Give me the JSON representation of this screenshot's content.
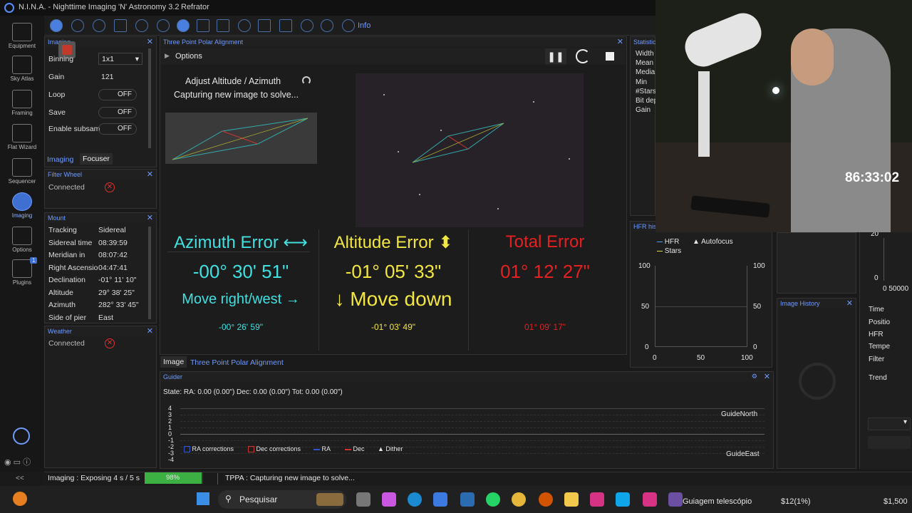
{
  "app": {
    "title": "N.I.N.A. - Nighttime Imaging 'N' Astronomy 3.2",
    "profile": "Refrator"
  },
  "nav": [
    {
      "label": "Equipment"
    },
    {
      "label": "Sky Atlas"
    },
    {
      "label": "Framing"
    },
    {
      "label": "Flat Wizard"
    },
    {
      "label": "Sequencer"
    },
    {
      "label": "Imaging"
    },
    {
      "label": "Options"
    },
    {
      "label": "Plugins"
    }
  ],
  "plugins_badge": "1",
  "toolbar": {
    "info": "Info"
  },
  "imaging_panel": {
    "title": "Imaging",
    "binning_label": "Binning",
    "binning_value": "1x1",
    "gain_label": "Gain",
    "gain_value": "121",
    "loop_label": "Loop",
    "loop_value": "OFF",
    "save_label": "Save",
    "save_value": "OFF",
    "subsample_label": "Enable subsam",
    "subsample_value": "OFF",
    "tab_imaging": "Imaging",
    "tab_focuser": "Focuser"
  },
  "filter_wheel": {
    "title": "Filter Wheel",
    "status": "Connected"
  },
  "mount": {
    "title": "Mount",
    "rows": [
      {
        "label": "Tracking",
        "value": "Sidereal"
      },
      {
        "label": "Sidereal time",
        "value": "08:39:59"
      },
      {
        "label": "Meridian in",
        "value": "08:07:42"
      },
      {
        "label": "Right Ascensio",
        "value": "04:47:41"
      },
      {
        "label": "Declination",
        "value": "-01° 11' 10\""
      },
      {
        "label": "Altitude",
        "value": "29° 38' 25\""
      },
      {
        "label": "Azimuth",
        "value": "282° 33' 45\""
      },
      {
        "label": "Side of pier",
        "value": "East"
      }
    ]
  },
  "weather": {
    "title": "Weather",
    "status": "Connected"
  },
  "tppa": {
    "title": "Three Point Polar Alignment",
    "options": "Options",
    "step": "Adjust Altitude / Azimuth",
    "step_status": "Capturing new image to solve...",
    "az_title": "Azimuth Error ⟷",
    "az_value": "-00° 30' 51\"",
    "az_hint": "Move right/west →",
    "az_small": "-00° 26' 59\"",
    "alt_title": "Altitude Error ⬍",
    "alt_value": "-01° 05' 33\"",
    "alt_hint": "↓ Move down",
    "alt_small": "-01° 03' 49\"",
    "tot_title": "Total Error",
    "tot_value": "01° 12' 27\"",
    "tot_small": "01° 09' 17\""
  },
  "center_tabs": {
    "image": "Image",
    "tppa": "Three Point Polar Alignment"
  },
  "statistics": {
    "title": "Statistics",
    "items": [
      "Width",
      "Mean",
      "Media",
      "Min",
      "#Stars",
      "Bit dep",
      "Gain"
    ]
  },
  "hfr": {
    "title": "HFR histo",
    "legend_hfr": "HFR",
    "legend_autofocus": "Autofocus",
    "legend_stars": "Stars",
    "yticks": [
      "100",
      "50",
      "0"
    ],
    "xticks": [
      "0",
      "50",
      "100"
    ]
  },
  "image_history": {
    "title": "Image History"
  },
  "right_cut": {
    "items": [
      "Time",
      "Positio",
      "HFR",
      "Tempe",
      "Filter",
      "Trend"
    ],
    "y20": "20",
    "y0": "0",
    "x": "0 50000"
  },
  "guider": {
    "title": "Guider",
    "state": "State:  RA: 0.00 (0.00\")  Dec: 0.00 (0.00\")  Tot: 0.00 (0.00\")",
    "yticks": [
      "4",
      "3",
      "2",
      "1",
      "0",
      "-1",
      "-2",
      "-3",
      "-4"
    ],
    "north": "GuideNorth",
    "east": "GuideEast",
    "legend": [
      "RA corrections",
      "Dec corrections",
      "RA",
      "Dec",
      "Dither"
    ]
  },
  "statusbar": {
    "imaging": "Imaging :   Exposing 4 s / 5 s",
    "progress": 0.98,
    "progress_label": "98%",
    "tppa": "TPPA :   Capturing new image to solve..."
  },
  "timer": "86:33:02",
  "taskbar": {
    "search": "Pesquisar",
    "item": "Guiagem telescópio",
    "price1": "$12(1%)",
    "price2": "$1,500"
  }
}
